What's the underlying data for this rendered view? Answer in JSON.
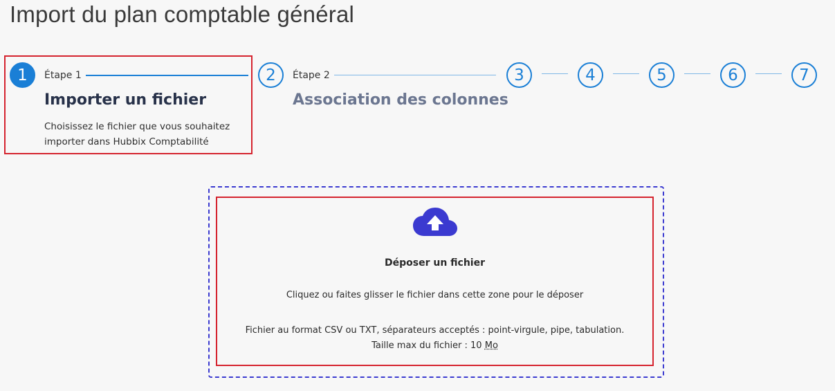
{
  "page": {
    "title": "Import du plan comptable général"
  },
  "stepper": {
    "steps": [
      {
        "number": "1",
        "label": "Étape 1",
        "title": "Importer un fichier",
        "description": "Choisissez le fichier que vous souhaitez importer dans Hubbix Comptabilité",
        "state": "active"
      },
      {
        "number": "2",
        "label": "Étape 2",
        "title": "Association des colonnes",
        "state": "upcoming"
      },
      {
        "number": "3",
        "state": "upcoming"
      },
      {
        "number": "4",
        "state": "upcoming"
      },
      {
        "number": "5",
        "state": "upcoming"
      },
      {
        "number": "6",
        "state": "upcoming"
      },
      {
        "number": "7",
        "state": "upcoming"
      }
    ]
  },
  "dropzone": {
    "icon": "cloud-upload-icon",
    "title": "Déposer un fichier",
    "instruction": "Cliquez ou faites glisser le fichier dans cette zone pour le déposer",
    "format_line": "Fichier au format CSV ou TXT, séparateurs acceptés : point-virgule, pipe, tabulation.",
    "max_size_label": "Taille max du fichier : 10",
    "max_size_unit": "Mo"
  },
  "colors": {
    "accent": "#1a7fd6",
    "highlight": "#d5232e",
    "dropzone_border": "#3b3ad0",
    "upload_icon": "#3b3ad0"
  }
}
